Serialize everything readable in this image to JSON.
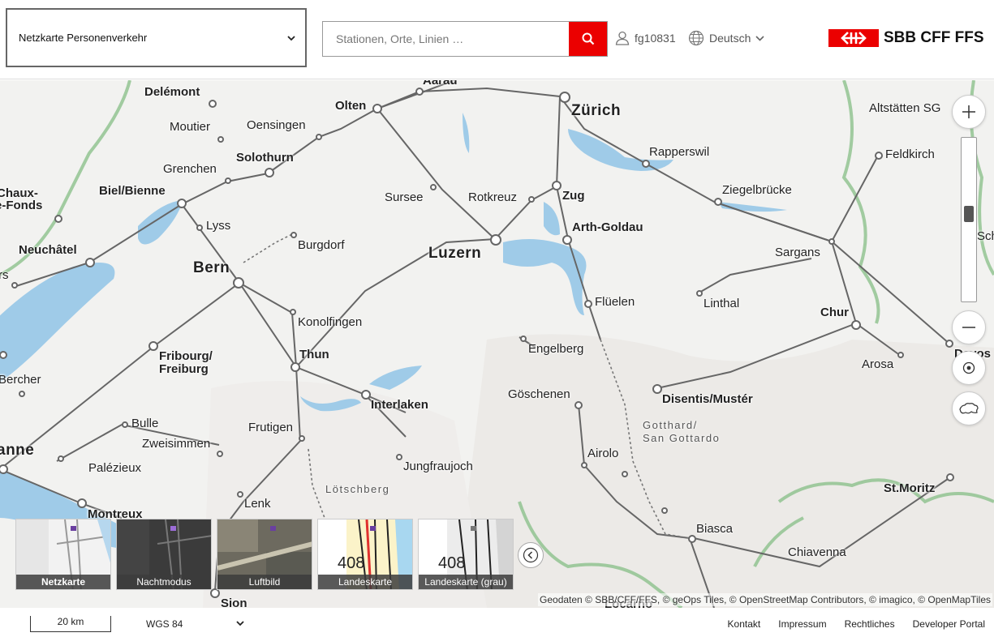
{
  "header": {
    "topic": "Netzkarte Personenverkehr",
    "search_placeholder": "Stationen, Orte, Linien …",
    "user": "fg10831",
    "language": "Deutsch",
    "logo_text": "SBB CFF FFS",
    "brand_color": "#eb0000"
  },
  "map": {
    "places": {
      "aarau": "Aarau",
      "delemont": "Delémont",
      "olten": "Olten",
      "zurich": "Zürich",
      "altstatten": "Altstätten SG",
      "moutier": "Moutier",
      "oensingen": "Oensingen",
      "rapperswil": "Rapperswil",
      "feldkirch": "Feldkirch",
      "solothurn": "Solothurn",
      "grenchen": "Grenchen",
      "chaux": "Chaux-",
      "fonds": "e-Fonds",
      "biel": "Biel/Bienne",
      "sursee": "Sursee",
      "rotkreuz": "Rotkreuz",
      "zug": "Zug",
      "ziegelbrucke": "Ziegelbrücke",
      "lyss": "Lyss",
      "arth": "Arth-Goldau",
      "burgdorf": "Burgdorf",
      "sch": "Sch",
      "neuchatel": "Neuchâtel",
      "luzern": "Luzern",
      "sargans": "Sargans",
      "bern": "Bern",
      "rs": "rs",
      "fluelen": "Flüelen",
      "linthal": "Linthal",
      "konolfingen": "Konolfingen",
      "chur": "Chur",
      "fribourg": "Fribourg/",
      "freiburg": "Freiburg",
      "engelberg": "Engelberg",
      "thun": "Thun",
      "arosa": "Arosa",
      "davos": "Davos",
      "bercher": "Bercher",
      "goschenen": "Göschenen",
      "interlaken": "Interlaken",
      "disentis": "Disentis/Mustér",
      "bulle": "Bulle",
      "frutigen": "Frutigen",
      "gotthard1": "Gotthard/",
      "gotthard2": "San Gottardo",
      "zweisimmen": "Zweisimmen",
      "anne": "anne",
      "airolo": "Airolo",
      "palezieux": "Palézieux",
      "jungfraujoch": "Jungfraujoch",
      "lotschberg": "Lötschberg",
      "stmoritz": "St.Moritz",
      "lenk": "Lenk",
      "montreux": "Montreux",
      "biasca": "Biasca",
      "chiavenna": "Chiavenna",
      "sion": "Sion",
      "locarno": "Locarno"
    },
    "attribution": "Geodaten © SBB/CFF/FFS, © geOps Tiles, © OpenStreetMap Contributors, © imagico, © OpenMapTiles",
    "zoom_level_fraction": 0.54
  },
  "basemaps": [
    {
      "label": "Netzkarte",
      "active": true
    },
    {
      "label": "Nachtmodus",
      "active": false
    },
    {
      "label": "Luftbild",
      "active": false
    },
    {
      "label": "Landeskarte",
      "active": false
    },
    {
      "label": "Landeskarte (grau)",
      "active": false
    }
  ],
  "footer": {
    "scale": "20 km",
    "crs": "WGS 84",
    "links": [
      "Kontakt",
      "Impressum",
      "Rechtliches",
      "Developer Portal"
    ]
  }
}
